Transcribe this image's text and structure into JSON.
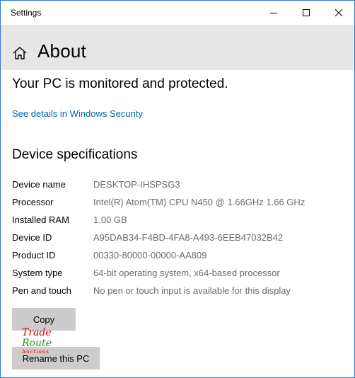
{
  "window": {
    "title": "Settings",
    "controls": {
      "minimize": "minimize-icon",
      "maximize": "maximize-icon",
      "close": "close-icon"
    }
  },
  "header": {
    "title": "About",
    "home_icon": "home-icon"
  },
  "protection": {
    "title": "Your PC is monitored and protected.",
    "link_label": "See details in Windows Security"
  },
  "specs": {
    "title": "Device specifications",
    "rows": [
      {
        "label": "Device name",
        "value": "DESKTOP-IHSPSG3"
      },
      {
        "label": "Processor",
        "value": "Intel(R) Atom(TM) CPU N450   @ 1.66GHz   1.66 GHz"
      },
      {
        "label": "Installed RAM",
        "value": "1.00 GB"
      },
      {
        "label": "Device ID",
        "value": "A95DAB34-F4BD-4FA8-A493-6EEB47032B42"
      },
      {
        "label": "Product ID",
        "value": "00330-80000-00000-AA809"
      },
      {
        "label": "System type",
        "value": "64-bit operating system, x64-based processor"
      },
      {
        "label": "Pen and touch",
        "value": "No pen or touch input is available for this display"
      }
    ]
  },
  "actions": {
    "copy_label": "Copy",
    "rename_label": "Rename this PC"
  },
  "watermark": {
    "line1": "Trade",
    "line2": "Route",
    "line3": "Auctions"
  },
  "colors": {
    "accent_link": "#0063b1",
    "header_bg": "#e6e6e6",
    "button_bg": "#cccccc",
    "window_border": "#2b79d6"
  }
}
